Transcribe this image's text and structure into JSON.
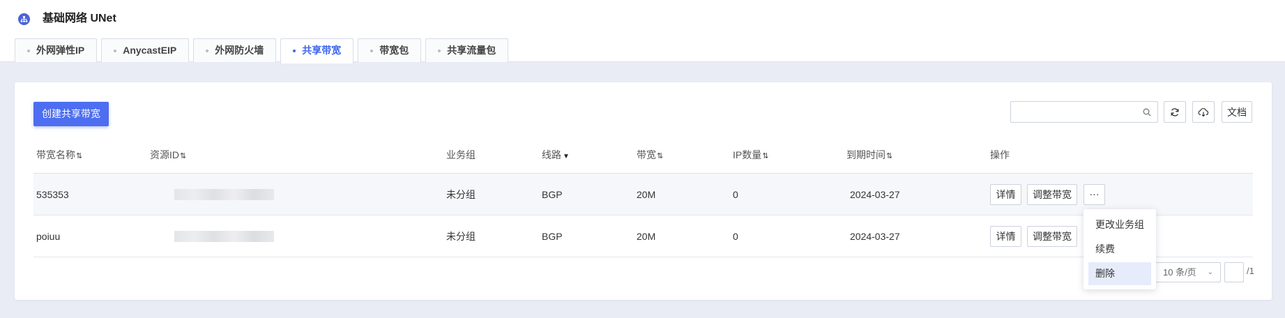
{
  "app": {
    "title": "基础网络 UNet"
  },
  "tabs": [
    {
      "label": "外网弹性IP",
      "active": false
    },
    {
      "label": "AnycastEIP",
      "active": false
    },
    {
      "label": "外网防火墙",
      "active": false
    },
    {
      "label": "共享带宽",
      "active": true
    },
    {
      "label": "带宽包",
      "active": false
    },
    {
      "label": "共享流量包",
      "active": false
    }
  ],
  "toolbar": {
    "create_label": "创建共享带宽",
    "search_placeholder": "",
    "doc_label": "文档"
  },
  "table": {
    "columns": [
      {
        "label": "带宽名称",
        "sortable": true,
        "filter": false
      },
      {
        "label": "资源ID",
        "sortable": true,
        "filter": false
      },
      {
        "label": "业务组",
        "sortable": false,
        "filter": false
      },
      {
        "label": "线路",
        "sortable": false,
        "filter": true
      },
      {
        "label": "带宽",
        "sortable": true,
        "filter": false
      },
      {
        "label": "IP数量",
        "sortable": true,
        "filter": false
      },
      {
        "label": "到期时间",
        "sortable": true,
        "filter": false
      },
      {
        "label": "操作",
        "sortable": false,
        "filter": false
      }
    ],
    "sort_glyph": "⇅",
    "filter_glyph": "▼",
    "rows": [
      {
        "name": "535353",
        "group": "未分组",
        "line": "BGP",
        "bandwidth": "20M",
        "ip_count": "0",
        "expire": "2024-03-27"
      },
      {
        "name": "poiuu",
        "group": "未分组",
        "line": "BGP",
        "bandwidth": "20M",
        "ip_count": "0",
        "expire": "2024-03-27"
      }
    ],
    "actions": {
      "detail": "详情",
      "adjust": "调整带宽",
      "more": "···"
    }
  },
  "dropdown": {
    "items": [
      {
        "label": "更改业务组",
        "selected": false
      },
      {
        "label": "续费",
        "selected": false
      },
      {
        "label": "删除",
        "selected": true
      }
    ]
  },
  "pagination": {
    "page_size": "10 条/页",
    "chevron": "⌄",
    "total": "/1"
  },
  "colors": {
    "accent": "#4d6ef0",
    "active_tab": "#3f66f0",
    "background": "#e9ecf5"
  }
}
